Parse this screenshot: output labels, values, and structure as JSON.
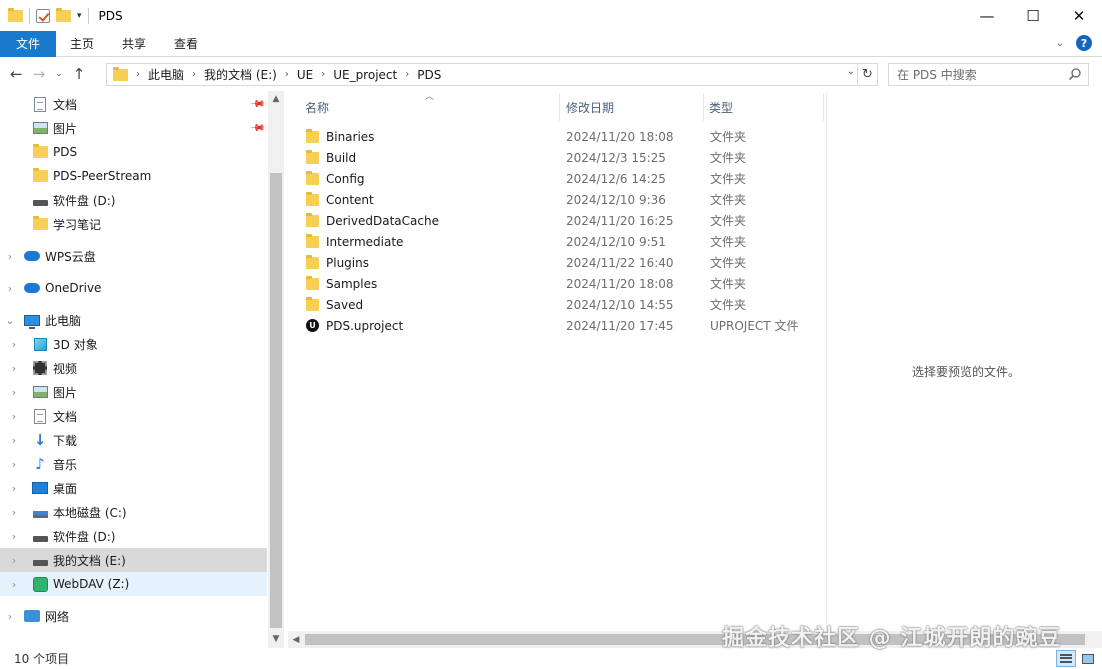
{
  "window": {
    "title": "PDS",
    "minimize": "—",
    "maximize": "☐",
    "close": "✕"
  },
  "ribbon": {
    "tabs": [
      "文件",
      "主页",
      "共享",
      "查看"
    ],
    "help": "?"
  },
  "address": {
    "crumbs": [
      "此电脑",
      "我的文档 (E:)",
      "UE",
      "UE_project",
      "PDS"
    ],
    "search_placeholder": "在 PDS 中搜索"
  },
  "nav_pane": {
    "quick_access": [
      {
        "label": "文档",
        "icon": "document-icon",
        "pinned": true
      },
      {
        "label": "图片",
        "icon": "picture-icon",
        "pinned": true
      },
      {
        "label": "PDS",
        "icon": "folder-icon"
      },
      {
        "label": "PDS-PeerStream",
        "icon": "folder-icon"
      },
      {
        "label": "软件盘 (D:)",
        "icon": "drive-icon"
      },
      {
        "label": "学习笔记",
        "icon": "folder-icon"
      }
    ],
    "roots": [
      {
        "label": "WPS云盘",
        "icon": "cloud-icon"
      },
      {
        "label": "OneDrive",
        "icon": "onedrive-icon"
      },
      {
        "label": "此电脑",
        "icon": "computer-icon"
      }
    ],
    "this_pc": [
      {
        "label": "3D 对象",
        "icon": "3d-objects-icon"
      },
      {
        "label": "视频",
        "icon": "video-icon"
      },
      {
        "label": "图片",
        "icon": "picture-icon"
      },
      {
        "label": "文档",
        "icon": "document-icon"
      },
      {
        "label": "下载",
        "icon": "download-icon"
      },
      {
        "label": "音乐",
        "icon": "music-icon"
      },
      {
        "label": "桌面",
        "icon": "desktop-icon"
      },
      {
        "label": "本地磁盘 (C:)",
        "icon": "system-drive-icon"
      },
      {
        "label": "软件盘 (D:)",
        "icon": "drive-icon"
      },
      {
        "label": "我的文档 (E:)",
        "icon": "drive-icon",
        "selected": true
      },
      {
        "label": "WebDAV (Z:)",
        "icon": "webdav-icon",
        "hovered": true
      }
    ],
    "network": {
      "label": "网络",
      "icon": "network-icon"
    }
  },
  "columns": {
    "name": "名称",
    "date": "修改日期",
    "type": "类型"
  },
  "files": [
    {
      "name": "Binaries",
      "date": "2024/11/20 18:08",
      "type": "文件夹",
      "icon": "folder-icon"
    },
    {
      "name": "Build",
      "date": "2024/12/3 15:25",
      "type": "文件夹",
      "icon": "folder-icon"
    },
    {
      "name": "Config",
      "date": "2024/12/6 14:25",
      "type": "文件夹",
      "icon": "folder-icon"
    },
    {
      "name": "Content",
      "date": "2024/12/10 9:36",
      "type": "文件夹",
      "icon": "folder-icon"
    },
    {
      "name": "DerivedDataCache",
      "date": "2024/11/20 16:25",
      "type": "文件夹",
      "icon": "folder-icon"
    },
    {
      "name": "Intermediate",
      "date": "2024/12/10 9:51",
      "type": "文件夹",
      "icon": "folder-icon"
    },
    {
      "name": "Plugins",
      "date": "2024/11/22 16:40",
      "type": "文件夹",
      "icon": "folder-icon"
    },
    {
      "name": "Samples",
      "date": "2024/11/20 18:08",
      "type": "文件夹",
      "icon": "folder-icon"
    },
    {
      "name": "Saved",
      "date": "2024/12/10 14:55",
      "type": "文件夹",
      "icon": "folder-icon"
    },
    {
      "name": "PDS.uproject",
      "date": "2024/11/20 17:45",
      "type": "UPROJECT 文件",
      "icon": "unreal-engine-icon"
    }
  ],
  "preview": {
    "text": "选择要预览的文件。"
  },
  "status": {
    "item_count": "10 个项目"
  },
  "watermark": "掘金技术社区 @ 江城开朗的豌豆",
  "colors": {
    "accent": "#1979ca",
    "folder": "#f7cf55",
    "selected": "#d9d9d9",
    "hover": "#e5f1fb"
  }
}
